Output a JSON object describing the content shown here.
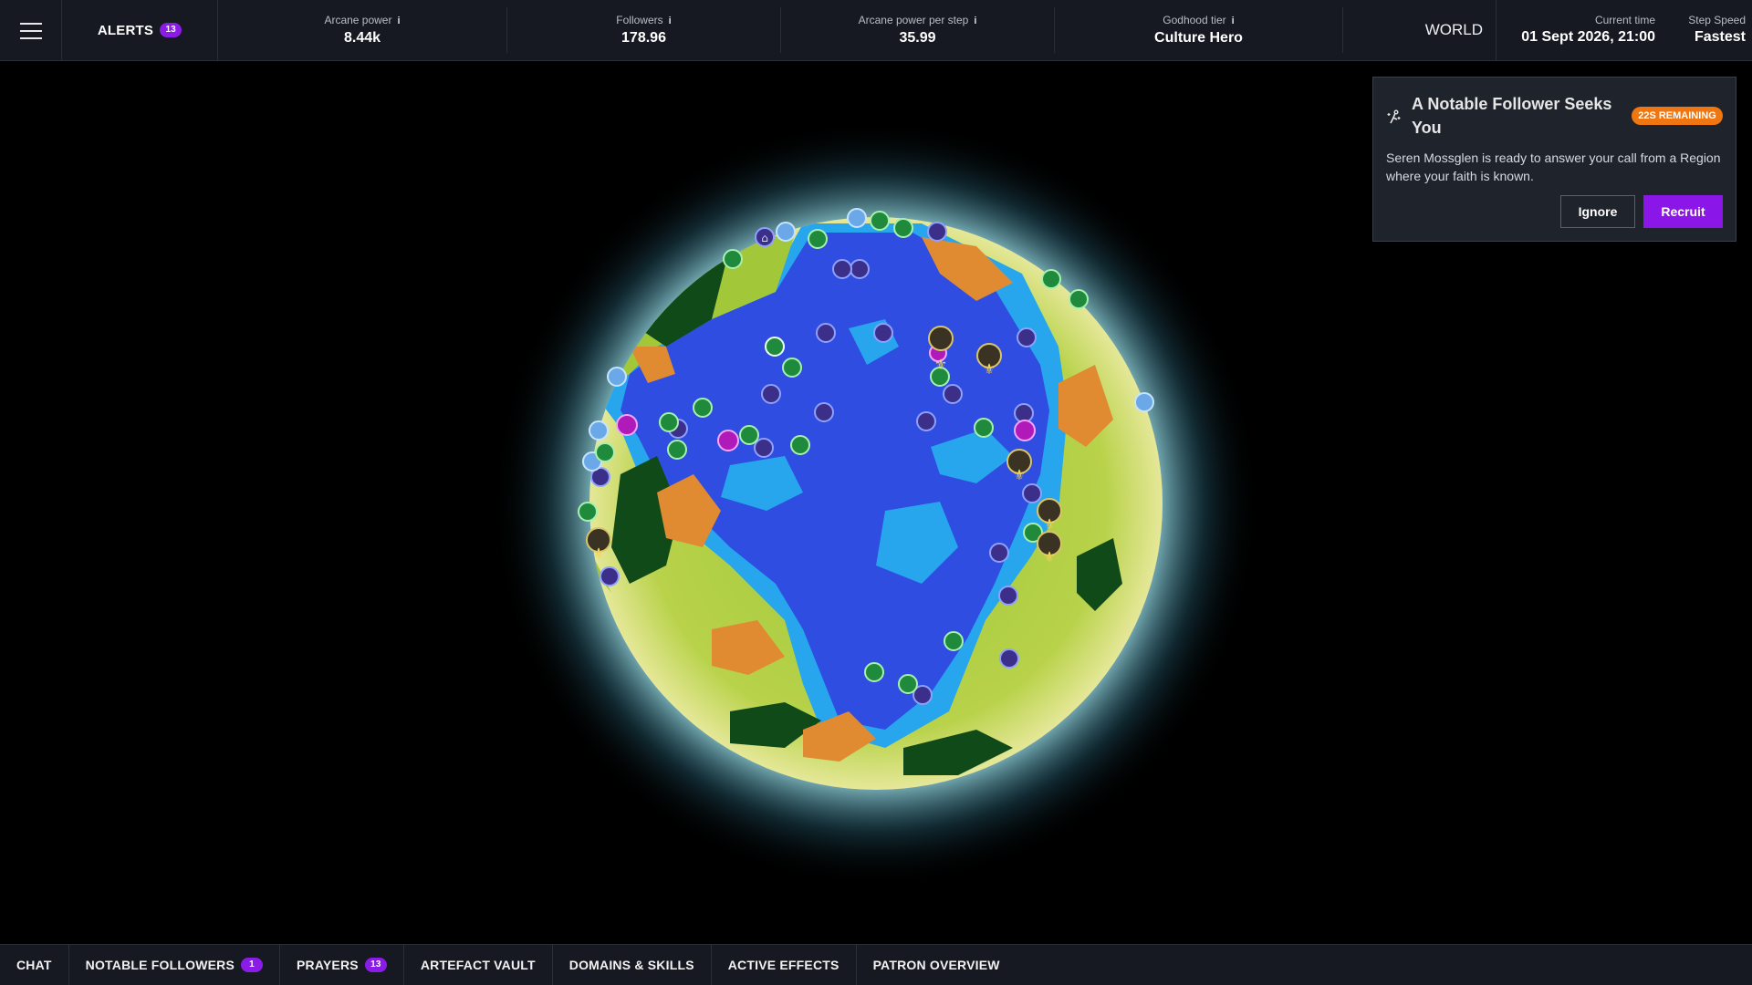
{
  "topbar": {
    "alerts_label": "ALERTS",
    "alerts_count": "13",
    "stats": [
      {
        "label": "Arcane power",
        "value": "8.44k",
        "info": "i"
      },
      {
        "label": "Followers",
        "value": "178.96",
        "info": "i"
      },
      {
        "label": "Arcane power per step",
        "value": "35.99",
        "info": "i"
      },
      {
        "label": "Godhood tier",
        "value": "Culture Hero",
        "info": "i"
      }
    ],
    "world_label": "WORLD",
    "current_time_label": "Current time",
    "current_time_value": "01 Sept 2026, 21:00",
    "step_speed_label": "Step Speed",
    "step_speed_value": "Fastest"
  },
  "event": {
    "title": "A Notable Follower Seeks You",
    "timer": "22S REMAINING",
    "body": "Seren Mossglen is ready to answer your call from a Region where your faith is known.",
    "ignore_label": "Ignore",
    "recruit_label": "Recruit"
  },
  "bottom_tabs": [
    {
      "label": "CHAT",
      "badge": ""
    },
    {
      "label": "NOTABLE FOLLOWERS",
      "badge": "1"
    },
    {
      "label": "PRAYERS",
      "badge": "13"
    },
    {
      "label": "ARTEFACT VAULT",
      "badge": ""
    },
    {
      "label": "DOMAINS & SKILLS",
      "badge": ""
    },
    {
      "label": "ACTIVE EFFECTS",
      "badge": ""
    },
    {
      "label": "PATRON OVERVIEW",
      "badge": ""
    }
  ],
  "map": {
    "marker_types": [
      "temple-icon",
      "shrine-icon",
      "house-icon",
      "notable-follower-icon"
    ],
    "colors": {
      "ocean": "#2f4de0",
      "shallow": "#27a6ee",
      "land": "#a6cc3a",
      "forest": "#0f4a18",
      "desert": "#e08a32",
      "glow": "#bfeaf0",
      "temple_marker": "#3c2f8a",
      "house_marker": "#1f8a3c",
      "shrine_marker": "#b01ab8",
      "follower_marker": "#3a3222"
    }
  }
}
